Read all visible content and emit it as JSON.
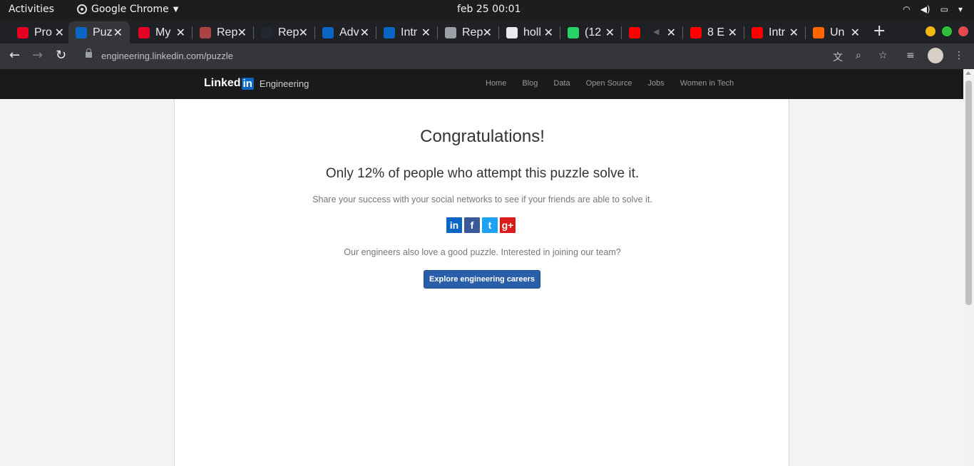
{
  "system_bar": {
    "activities": "Activities",
    "app_name": "Google Chrome",
    "clock": "feb 25  00:01"
  },
  "tabs": [
    {
      "title": "Pro",
      "icon": "pinterest-like-icon",
      "color": "#e60023"
    },
    {
      "title": "Puz",
      "icon": "linkedin-icon",
      "color": "#0a66c2",
      "active": true
    },
    {
      "title": "My",
      "icon": "pinterest-like-icon",
      "color": "#e60023"
    },
    {
      "title": "Rep",
      "icon": "terminal-icon",
      "color": "#aa4444"
    },
    {
      "title": "Rep",
      "icon": "app-icon",
      "color": "#222831"
    },
    {
      "title": "Adv",
      "icon": "linkedin-icon",
      "color": "#0a66c2"
    },
    {
      "title": "Intr",
      "icon": "linkedin-icon",
      "color": "#0a66c2"
    },
    {
      "title": "Rep",
      "icon": "globe-icon",
      "color": "#9aa0a6"
    },
    {
      "title": "holl",
      "icon": "github-icon",
      "color": "#e8eaed"
    },
    {
      "title": "(12",
      "icon": "whatsapp-icon",
      "color": "#25d366"
    },
    {
      "title": "",
      "icon": "youtube-icon",
      "color": "#ff0000",
      "muted": true
    },
    {
      "title": "8 E",
      "icon": "youtube-icon",
      "color": "#ff0000"
    },
    {
      "title": "Intr",
      "icon": "youtube-icon",
      "color": "#ff0000"
    },
    {
      "title": "Un",
      "icon": "ycombinator-icon",
      "color": "#ff6600"
    }
  ],
  "toolbar": {
    "url": "engineering.linkedin.com/puzzle"
  },
  "site": {
    "logo_text": "Linked",
    "logo_in": "in",
    "logo_suffix": "Engineering",
    "nav": [
      "Home",
      "Blog",
      "Data",
      "Open Source",
      "Jobs",
      "Women in Tech"
    ]
  },
  "content": {
    "title": "Congratulations!",
    "subtitle": "Only 12% of people who attempt this puzzle solve it.",
    "share_text": "Share your success with your social networks to see if your friends are able to solve it.",
    "join_text": "Our engineers also love a good puzzle. Interested in joining our team?",
    "cta_label": "Explore engineering careers"
  },
  "social": [
    {
      "icon": "linkedin-share-icon",
      "glyph": "in",
      "color": "#0a66c2"
    },
    {
      "icon": "facebook-share-icon",
      "glyph": "f",
      "color": "#3b5998"
    },
    {
      "icon": "twitter-share-icon",
      "glyph": "t",
      "color": "#1da1f2"
    },
    {
      "icon": "googleplus-share-icon",
      "glyph": "g+",
      "color": "#dd1a1a"
    }
  ]
}
